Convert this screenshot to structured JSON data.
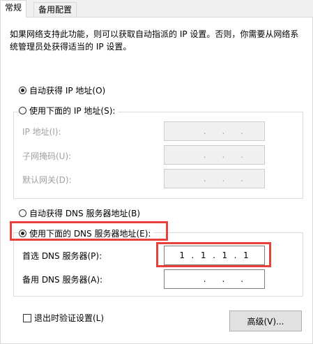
{
  "tabs": {
    "general": "常规",
    "alternate": "备用配置"
  },
  "description": "如果网络支持此功能，则可以获取自动指派的 IP 设置。否则，你需要从网络系统管理员处获得适当的 IP 设置。",
  "ip": {
    "auto_label": "自动获得 IP 地址(O)",
    "manual_label": "使用下面的 IP 地址(S):",
    "selected": "auto",
    "address_label": "IP 地址(I):",
    "subnet_label": "子网掩码(U):",
    "gateway_label": "默认网关(D):",
    "address_value": [
      "",
      "",
      "",
      ""
    ],
    "subnet_value": [
      "",
      "",
      "",
      ""
    ],
    "gateway_value": [
      "",
      "",
      "",
      ""
    ]
  },
  "dns": {
    "auto_label": "自动获得 DNS 服务器地址(B)",
    "manual_label": "使用下面的 DNS 服务器地址(E):",
    "selected": "manual",
    "preferred_label": "首选 DNS 服务器(P):",
    "alternate_label": "备用 DNS 服务器(A):",
    "preferred_value": [
      "1",
      "1",
      "1",
      "1"
    ],
    "alternate_value": [
      "",
      "",
      "",
      ""
    ]
  },
  "validate_on_exit_label": "退出时验证设置(L)",
  "validate_on_exit_checked": false,
  "advanced_button": "高级(V)...",
  "colors": {
    "highlight": "#e8403a",
    "panel_bg": "#ffffff",
    "window_bg": "#f0f0f0"
  }
}
